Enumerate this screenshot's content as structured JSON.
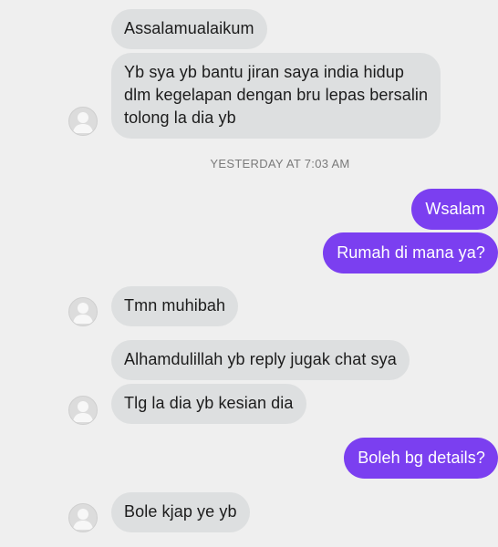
{
  "thread": {
    "incoming_1": "Assalamualaikum",
    "incoming_2": "Yb sya yb bantu jiran saya india hidup\ndlm kegelapan dengan bru lepas bersalin\ntolong la dia yb",
    "timestamp": "YESTERDAY AT 7:03 AM",
    "outgoing_1": "Wsalam",
    "outgoing_2": "Rumah di mana ya?",
    "incoming_3": "Tmn muhibah",
    "incoming_4": "Alhamdulillah yb reply jugak chat sya",
    "incoming_5": "Tlg la dia yb kesian dia",
    "outgoing_3": "Boleh bg details?",
    "incoming_6": "Bole kjap ye yb"
  },
  "colors": {
    "background": "#efefef",
    "incoming_bubble": "#dddfe0",
    "outgoing_bubble": "#7b3ff0",
    "timestamp_text": "#7a7a7a"
  },
  "icons": {
    "avatar": "default-profile-icon"
  }
}
